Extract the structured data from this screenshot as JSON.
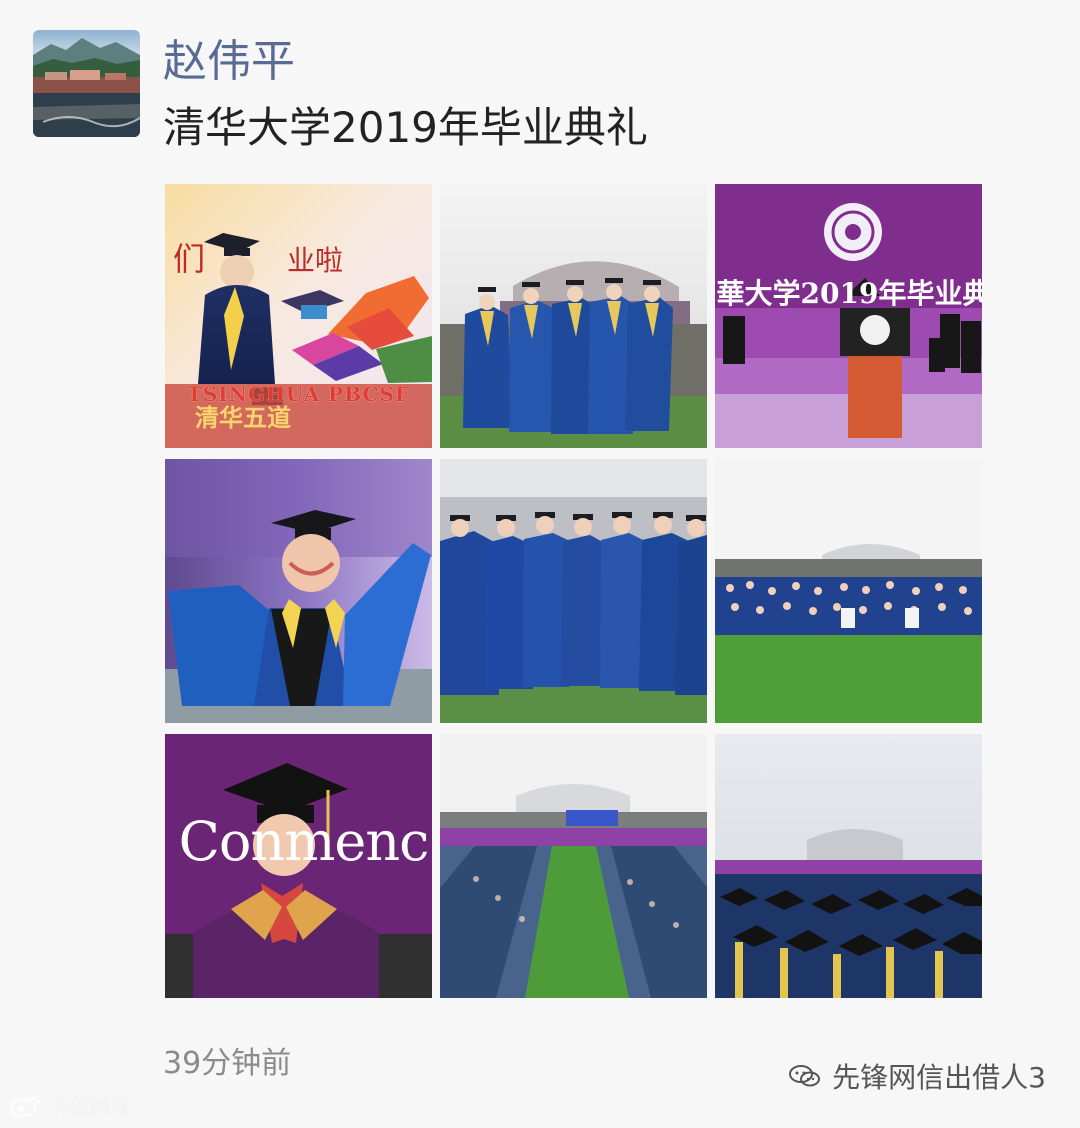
{
  "post": {
    "author_name": "赵伟平",
    "text": "清华大学2019年毕业典礼",
    "timestamp": "39分钟前"
  },
  "photos": [
    {
      "name": "photo-1",
      "caption": "TSINGHUA PBCSF"
    },
    {
      "name": "photo-2",
      "caption": ""
    },
    {
      "name": "photo-3",
      "caption": "華大学2019年毕业典"
    },
    {
      "name": "photo-4",
      "caption": ""
    },
    {
      "name": "photo-5",
      "caption": ""
    },
    {
      "name": "photo-6",
      "caption": ""
    },
    {
      "name": "photo-7",
      "caption": "Conmenc"
    },
    {
      "name": "photo-8",
      "caption": ""
    },
    {
      "name": "photo-9",
      "caption": ""
    }
  ],
  "watermarks": {
    "left": "大数跨境",
    "right": "先锋网信出借人3"
  },
  "colors": {
    "name_blue": "#576b95",
    "timestamp_gray": "#8b8b8b",
    "tsinghua_purple": "#7f2e8d"
  }
}
